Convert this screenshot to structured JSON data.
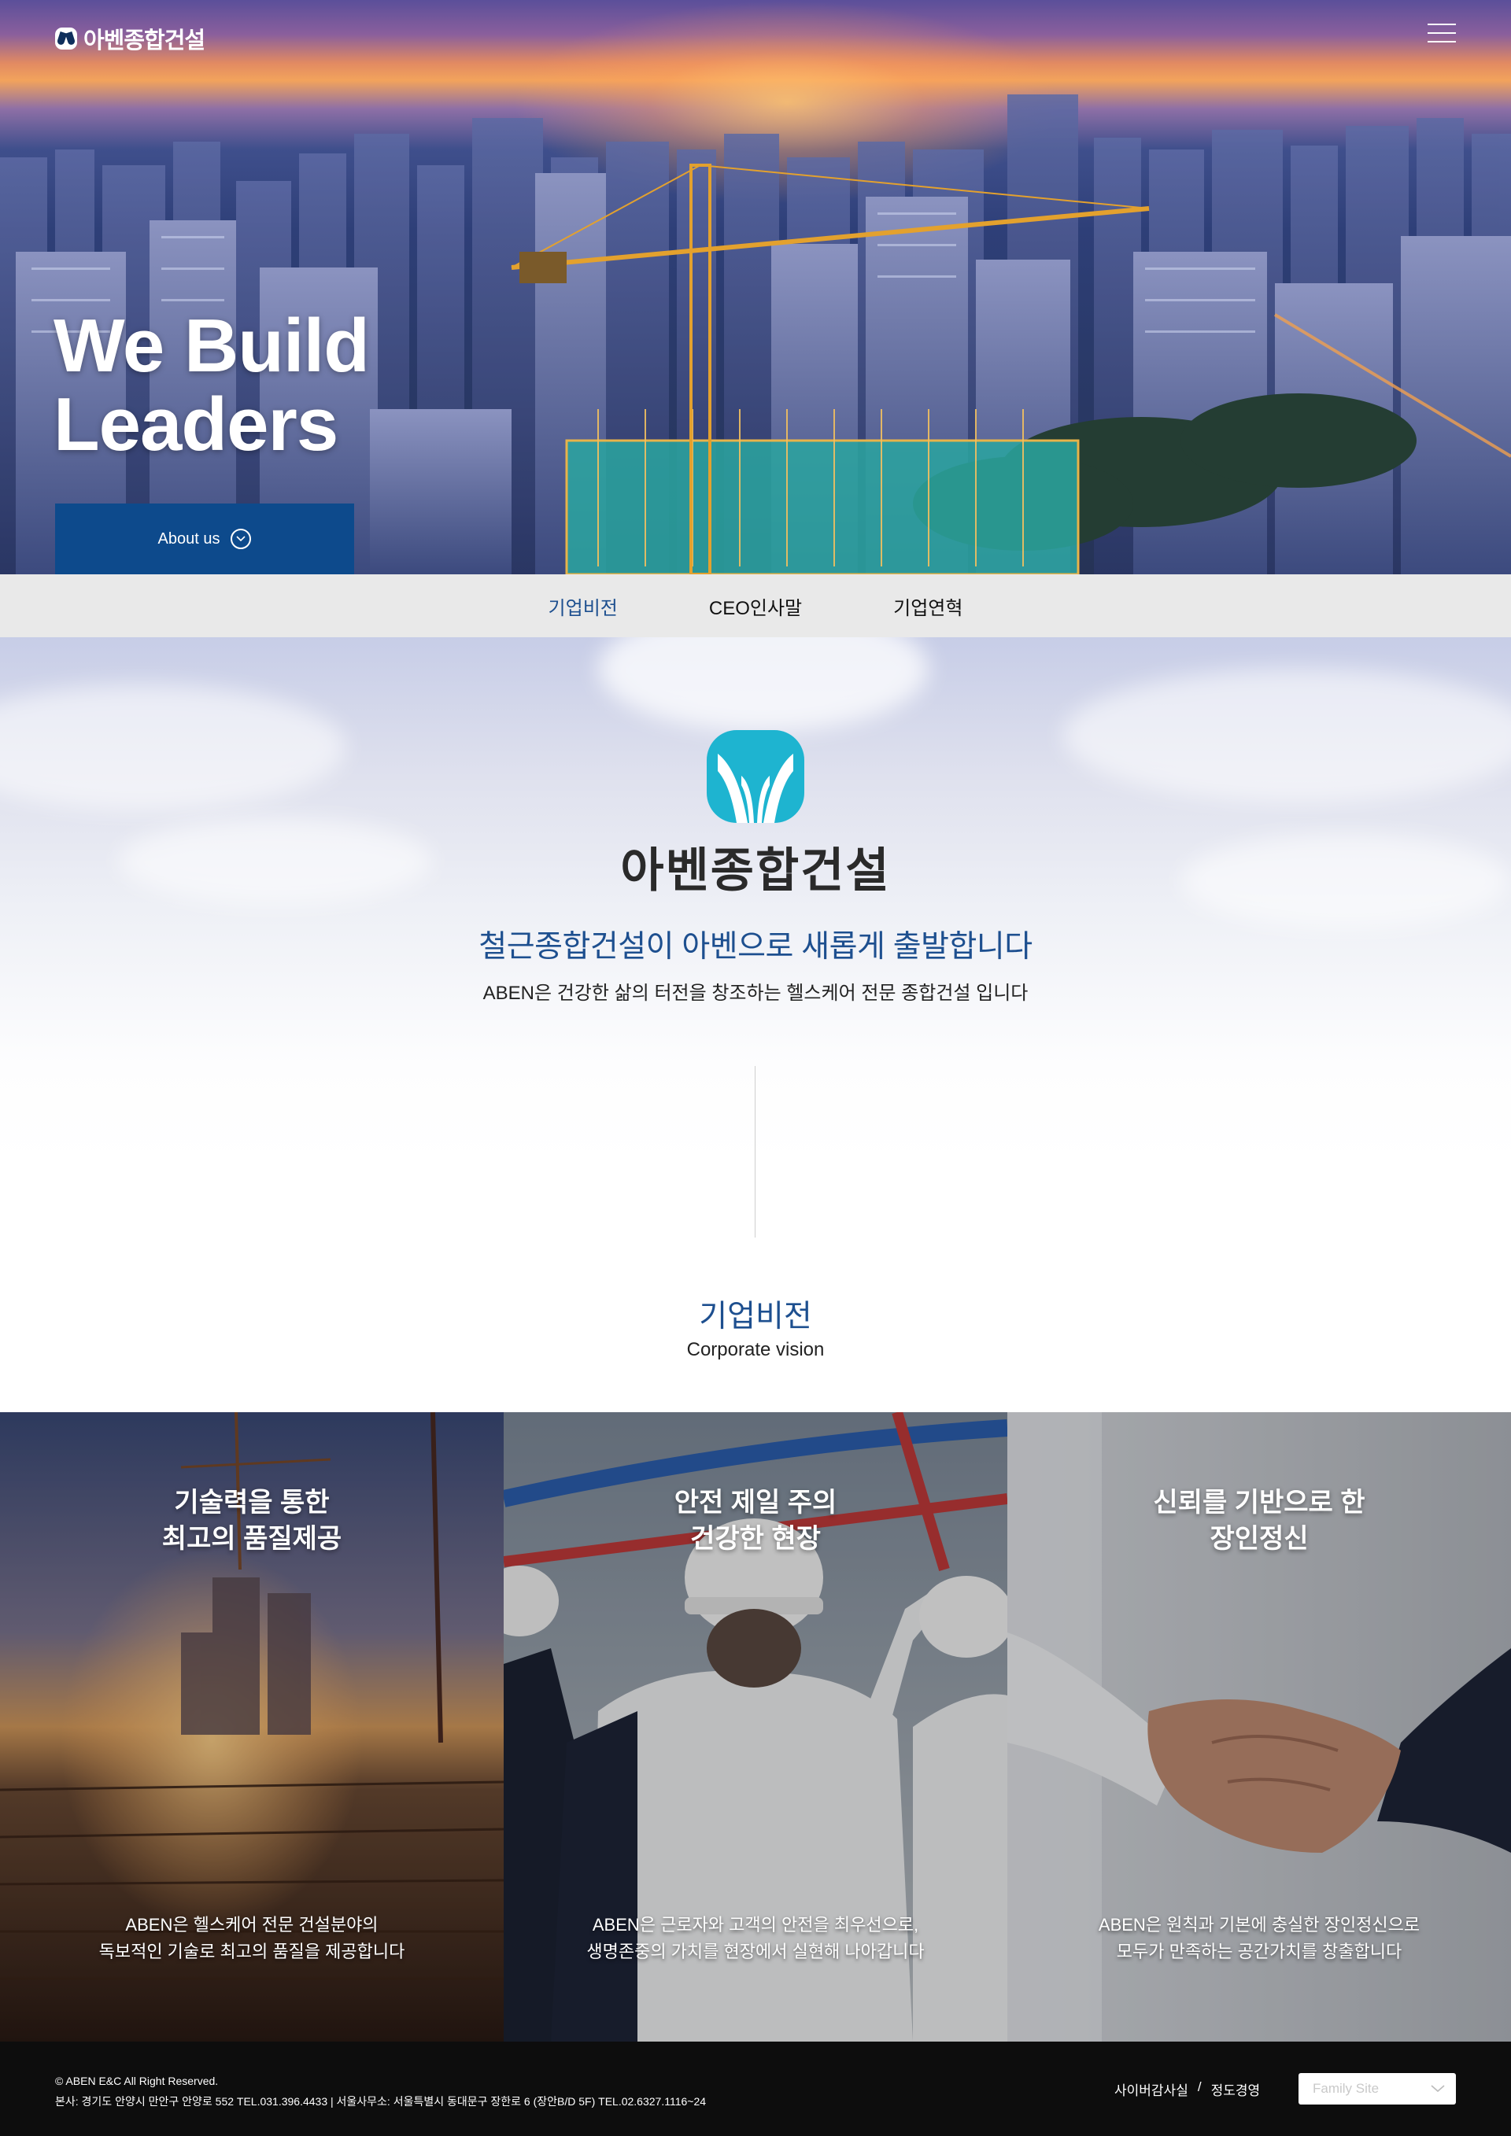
{
  "header": {
    "logo_text": "아벤종합건설",
    "menu_icon": "hamburger-menu-icon"
  },
  "hero": {
    "headline_line1": "We Build",
    "headline_line2": "Leaders",
    "about_button_label": "About us",
    "about_button_icon": "chevron-down-circle-icon"
  },
  "subnav": {
    "items": [
      {
        "label": "기업비전",
        "active": true
      },
      {
        "label": "CEO인사말",
        "active": false
      },
      {
        "label": "기업연혁",
        "active": false
      }
    ]
  },
  "intro": {
    "brand_name": "아벤종합건설",
    "slogan": "철근종합건설이 아벤으로 새롭게 출발합니다",
    "description": "ABEN은 건강한 삶의 터전을 창조하는 헬스케어 전문 종합건설 입니다",
    "vision_title": "기업비전",
    "vision_subtitle": "Corporate vision"
  },
  "cards": [
    {
      "title_line1": "기술력을 통한",
      "title_line2": "최고의 품질제공",
      "text_line1": "ABEN은 헬스케어 전문 건설분야의",
      "text_line2": "독보적인 기술로 최고의 품질을 제공합니다"
    },
    {
      "title_line1": "안전 제일 주의",
      "title_line2": "건강한 현장",
      "text_line1": "ABEN은 근로자와 고객의 안전을 최우선으로,",
      "text_line2": "생명존중의 가치를 현장에서 실현해 나아갑니다"
    },
    {
      "title_line1": "신뢰를 기반으로 한",
      "title_line2": "장인정신",
      "text_line1": "ABEN은 원칙과 기본에 충실한 장인정신으로",
      "text_line2": "모두가 만족하는 공간가치를 창출합니다"
    }
  ],
  "footer": {
    "copyright": "© ABEN E&C All Right Reserved.",
    "address": "본사: 경기도 안양시 만안구 안양로 552  TEL.031.396.4433  |   서울사무소: 서울특별시 동대문구 장한로 6 (장안B/D 5F) TEL.02.6327.1116~24",
    "link_audit": "사이버감사실",
    "separator": "/",
    "link_ethics": "정도경영",
    "family_site_placeholder": "Family Site"
  },
  "colors": {
    "accent_blue": "#1d4f8c",
    "button_blue": "#0d4a8c",
    "emblem_cyan": "#1eb4d0",
    "subnav_bg": "#e9e9e9",
    "footer_bg": "#0d0d0d"
  }
}
